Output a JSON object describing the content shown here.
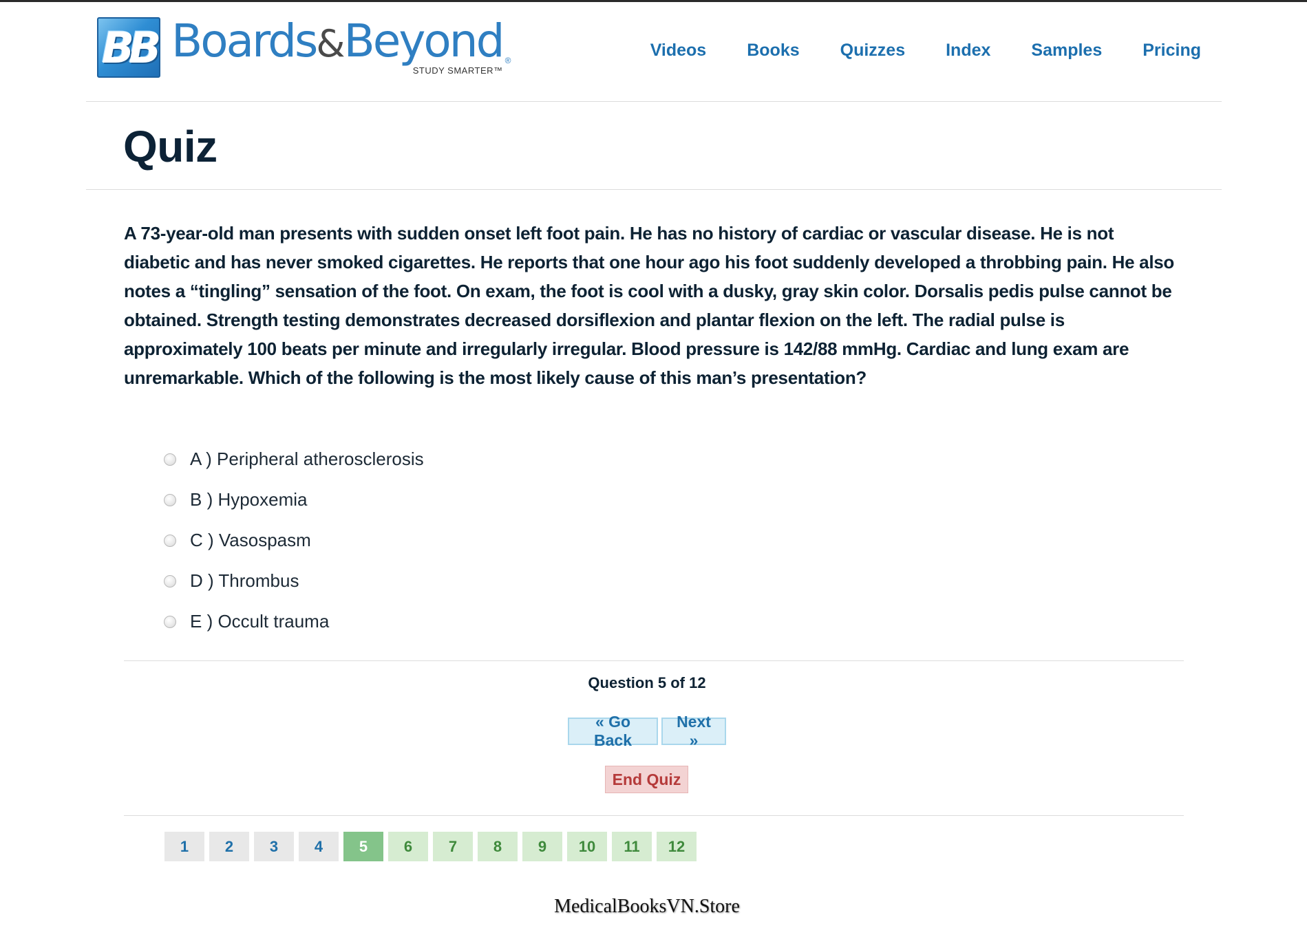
{
  "logo": {
    "mark": "BB",
    "word_left": "Boards",
    "word_amp": "&",
    "word_right": "Beyond",
    "registered": "®",
    "tagline": "STUDY SMARTER™"
  },
  "nav": {
    "items": [
      "Videos",
      "Books",
      "Quizzes",
      "Index",
      "Samples",
      "Pricing"
    ]
  },
  "page": {
    "title": "Quiz"
  },
  "question": {
    "text": "A 73-year-old man presents with sudden onset left foot pain. He has no history of cardiac or vascular disease. He is not diabetic and has never smoked cigarettes. He reports that one hour ago his foot suddenly developed a throbbing pain. He also notes a “tingling” sensation of the foot. On exam, the foot is cool with a dusky, gray skin color. Dorsalis pedis pulse cannot be obtained. Strength testing demonstrates decreased dorsiflexion and plantar flexion on the left. The radial pulse is approximately 100 beats per minute and irregularly irregular. Blood pressure is 142/88 mmHg. Cardiac and lung exam are unremarkable. Which of the following is the most likely cause of this man’s presentation?",
    "answers": [
      "A ) Peripheral atherosclerosis",
      "B ) Hypoxemia",
      "C ) Vasospasm",
      "D ) Thrombus",
      "E ) Occult trauma"
    ]
  },
  "progress": {
    "counter": "Question 5 of 12"
  },
  "controls": {
    "back_label": "« Go Back",
    "next_label": "Next »",
    "end_label": "End Quiz"
  },
  "pagination": {
    "pages": [
      "1",
      "2",
      "3",
      "4",
      "5",
      "6",
      "7",
      "8",
      "9",
      "10",
      "11",
      "12"
    ],
    "current": "5"
  },
  "watermark": "MedicalBooksVN.Store",
  "colors": {
    "nav_link": "#1c6fae",
    "title": "#0c2236",
    "page_current": "#84c48a",
    "page_pending": "#d6ecd1",
    "page_visited": "#e8e8e8",
    "end_button": "#f3d3d3"
  }
}
